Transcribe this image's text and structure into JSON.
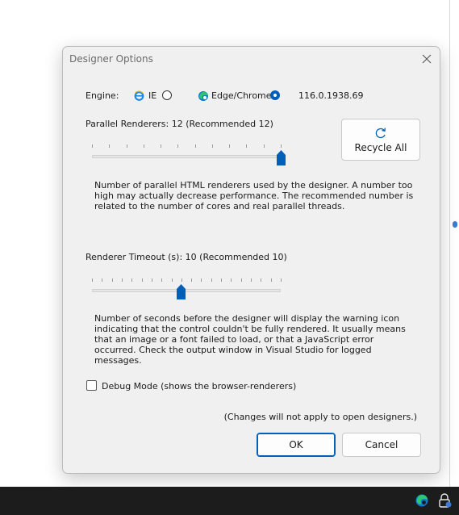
{
  "dialog": {
    "title": "Designer Options",
    "engine": {
      "label": "Engine:",
      "options": [
        {
          "label": "IE",
          "selected": false
        },
        {
          "label": "Edge/Chrome",
          "selected": true
        }
      ],
      "version": "116.0.1938.69"
    },
    "parallel": {
      "label": "Parallel Renderers: 12 (Recommended 12)",
      "value": 12,
      "min": 1,
      "max": 12,
      "description": "Number of parallel HTML renderers used by the designer. A number too high may actually decrease performance. The recommended number is related to the number of cores and real parallel threads."
    },
    "recycle_button": "Recycle All",
    "timeout": {
      "label": "Renderer Timeout (s): 10 (Recommended 10)",
      "value": 10,
      "min": 1,
      "max": 20,
      "description": "Number of seconds before the designer will display the warning icon indicating that the control couldn't be fully rendered. It usually means that an image or a font failed to load, or that a JavaScript error occurred. Check the output window in Visual Studio for logged messages."
    },
    "debug_mode": {
      "label": "Debug Mode (shows the browser-renderers)",
      "checked": false
    },
    "note": "(Changes will not apply to open designers.)",
    "ok_button": "OK",
    "cancel_button": "Cancel"
  },
  "colors": {
    "accent": "#005fb8",
    "taskbar": "#1c1c1c"
  },
  "icons": {
    "close": "close-icon",
    "ie": "ie-icon",
    "edge": "edge-icon",
    "recycle": "refresh-icon",
    "tray_edge": "edge-icon",
    "tray_lock": "lock-icon"
  }
}
